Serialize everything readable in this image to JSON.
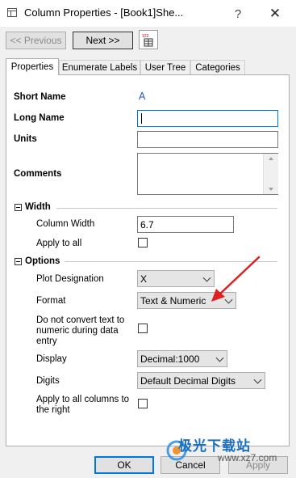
{
  "window": {
    "title": "Column Properties - [Book1]She...",
    "help_glyph": "?",
    "close_glyph": "✕"
  },
  "nav": {
    "prev_label": "<< Previous",
    "next_label": "Next >>",
    "worksheet_icon_text": "123"
  },
  "tabs": [
    {
      "label": "Properties",
      "active": true
    },
    {
      "label": "Enumerate Labels",
      "active": false
    },
    {
      "label": "User Tree",
      "active": false
    },
    {
      "label": "Categories",
      "active": false
    }
  ],
  "fields": {
    "short_name_label": "Short Name",
    "short_name_value": "A",
    "long_name_label": "Long Name",
    "long_name_value": "",
    "units_label": "Units",
    "units_value": "",
    "comments_label": "Comments",
    "comments_value": ""
  },
  "width_section": {
    "title": "Width",
    "column_width_label": "Column Width",
    "column_width_value": "6.7",
    "apply_to_all_label": "Apply to all"
  },
  "options_section": {
    "title": "Options",
    "plot_designation_label": "Plot Designation",
    "plot_designation_value": "X",
    "format_label": "Format",
    "format_value": "Text & Numeric",
    "no_convert_label_1": "Do not convert text to",
    "no_convert_label_2": "numeric during data",
    "no_convert_label_3": "entry",
    "display_label": "Display",
    "display_value": "Decimal:1000",
    "digits_label": "Digits",
    "digits_value": "Default Decimal Digits",
    "apply_all_right_label_1": "Apply to all columns to",
    "apply_all_right_label_2": "the right"
  },
  "buttons": {
    "ok": "OK",
    "cancel": "Cancel",
    "apply": "Apply"
  },
  "watermark": {
    "text": "极光下载站",
    "url": "www.xz7.com"
  },
  "colors": {
    "short_name_value": "#1e5bbd",
    "arrow": "#e02020",
    "focus": "#0078d7"
  }
}
